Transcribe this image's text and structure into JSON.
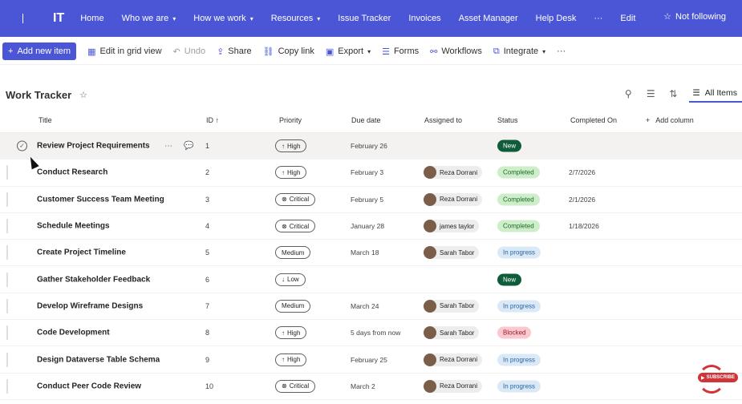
{
  "topbar": {
    "site": "IT",
    "nav": [
      {
        "label": "Home",
        "chevron": false
      },
      {
        "label": "Who we are",
        "chevron": true
      },
      {
        "label": "How we work",
        "chevron": true
      },
      {
        "label": "Resources",
        "chevron": true
      },
      {
        "label": "Issue Tracker",
        "chevron": false
      },
      {
        "label": "Invoices",
        "chevron": false
      },
      {
        "label": "Asset Manager",
        "chevron": false
      },
      {
        "label": "Help Desk",
        "chevron": false
      },
      {
        "label": "···",
        "chevron": false
      },
      {
        "label": "Edit",
        "chevron": false
      }
    ],
    "follow_label": "Not following"
  },
  "commandbar": {
    "add_new": "Add new item",
    "edit_grid": "Edit in grid view",
    "undo": "Undo",
    "share": "Share",
    "copy_link": "Copy link",
    "export": "Export",
    "forms": "Forms",
    "workflows": "Workflows",
    "integrate": "Integrate",
    "more": "···"
  },
  "list": {
    "title": "Work Tracker",
    "view": "All Items"
  },
  "columns": {
    "title": "Title",
    "id": "ID",
    "id_sort": "↑",
    "priority": "Priority",
    "due": "Due date",
    "assigned": "Assigned to",
    "status": "Status",
    "completed": "Completed On",
    "add": "Add column"
  },
  "rows": [
    {
      "title": "Review Project Requirements",
      "id": "1",
      "priority": "High",
      "priority_icon": "↑",
      "due": "February 26",
      "assigned": "",
      "status": "New",
      "completed": ""
    },
    {
      "title": "Conduct Research",
      "id": "2",
      "priority": "High",
      "priority_icon": "↑",
      "due": "February 3",
      "assigned": "Reza Dorrani",
      "status": "Completed",
      "completed": "2/7/2026"
    },
    {
      "title": "Customer Success Team Meeting",
      "id": "3",
      "priority": "Critical",
      "priority_icon": "⊗",
      "due": "February 5",
      "assigned": "Reza Dorrani",
      "status": "Completed",
      "completed": "2/1/2026"
    },
    {
      "title": "Schedule Meetings",
      "id": "4",
      "priority": "Critical",
      "priority_icon": "⊗",
      "due": "January 28",
      "assigned": "james taylor",
      "status": "Completed",
      "completed": "1/18/2026"
    },
    {
      "title": "Create Project Timeline",
      "id": "5",
      "priority": "Medium",
      "priority_icon": "",
      "due": "March 18",
      "assigned": "Sarah Tabor",
      "status": "In progress",
      "completed": ""
    },
    {
      "title": "Gather Stakeholder Feedback",
      "id": "6",
      "priority": "Low",
      "priority_icon": "↓",
      "due": "",
      "assigned": "",
      "status": "New",
      "completed": ""
    },
    {
      "title": "Develop Wireframe Designs",
      "id": "7",
      "priority": "Medium",
      "priority_icon": "",
      "due": "March 24",
      "assigned": "Sarah Tabor",
      "status": "In progress",
      "completed": ""
    },
    {
      "title": "Code Development",
      "id": "8",
      "priority": "High",
      "priority_icon": "↑",
      "due": "5 days from now",
      "assigned": "Sarah Tabor",
      "status": "Blocked",
      "completed": ""
    },
    {
      "title": "Design Dataverse Table Schema",
      "id": "9",
      "priority": "High",
      "priority_icon": "↑",
      "due": "February 25",
      "assigned": "Reza Dorrani",
      "status": "In progress",
      "completed": ""
    },
    {
      "title": "Conduct Peer Code Review",
      "id": "10",
      "priority": "Critical",
      "priority_icon": "⊗",
      "due": "March 2",
      "assigned": "Reza Dorrani",
      "status": "In progress",
      "completed": ""
    }
  ],
  "status_colors": {
    "New": {
      "bg": "#0e5c3a",
      "fg": "#ffffff"
    },
    "Completed": {
      "bg": "#cdeec9",
      "fg": "#1b6b2d"
    },
    "In progress": {
      "bg": "#dbe9f7",
      "fg": "#2566a6"
    },
    "Blocked": {
      "bg": "#f9c9cf",
      "fg": "#9a1b2b"
    }
  },
  "subscribe": "SUBSCRIBE"
}
